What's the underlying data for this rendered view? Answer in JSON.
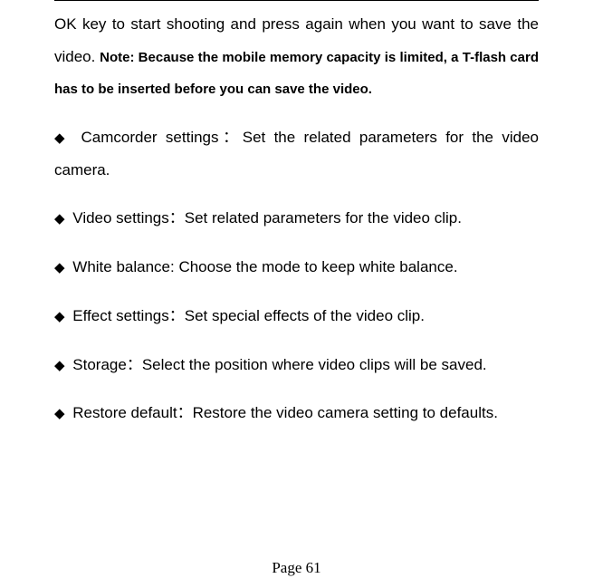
{
  "intro": {
    "text_before_note": "OK key to start shooting and press again when you want to save the video. ",
    "note": "Note: Because the mobile memory capacity is limited, a T-flash card has to be inserted before you can save the video."
  },
  "bullets": [
    "Camcorder settings：Set the related parameters for the video camera.",
    "Video settings：Set related parameters for the video clip.",
    "White balance: Choose the mode to keep white balance.",
    "Effect settings：Set special effects of the video clip.",
    "Storage：Select the position where video clips will be saved.",
    "Restore default：Restore the video camera setting to defaults."
  ],
  "page_number": "Page 61",
  "diamond_glyph": "◆"
}
